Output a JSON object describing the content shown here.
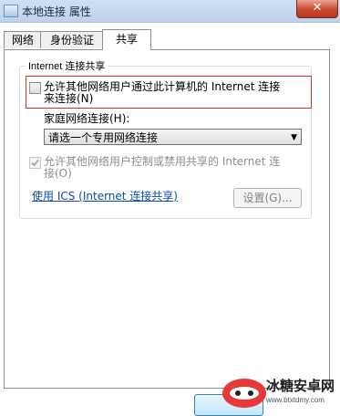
{
  "window": {
    "title": "本地连接 属性",
    "close_symbol": "✕"
  },
  "tabs": [
    {
      "label": "网络",
      "active": false
    },
    {
      "label": "身份验证",
      "active": false
    },
    {
      "label": "共享",
      "active": true
    }
  ],
  "sharing": {
    "group_caption": "Internet 连接共享",
    "allow_share": {
      "line1": "允许其他网络用户通过此计算机的 Internet 连接",
      "line2": "来连接(N)",
      "checked": false
    },
    "home_network_label": "家庭网络连接(H):",
    "home_network_select": {
      "value": "请选一个专用网络连接"
    },
    "allow_control": {
      "line1": "允许其他网络用户控制或禁用共享的 Internet 连",
      "line2": "接(O)",
      "checked": true,
      "disabled": true
    },
    "ics_link": "使用 ICS (Internet 连接共享)",
    "settings_button": "设置(G)..."
  },
  "watermark": {
    "text": "冰糖安卓网",
    "url": "www.btxtdmy.com"
  },
  "colors": {
    "highlight": "#e0312a",
    "link": "#0a4dac"
  }
}
